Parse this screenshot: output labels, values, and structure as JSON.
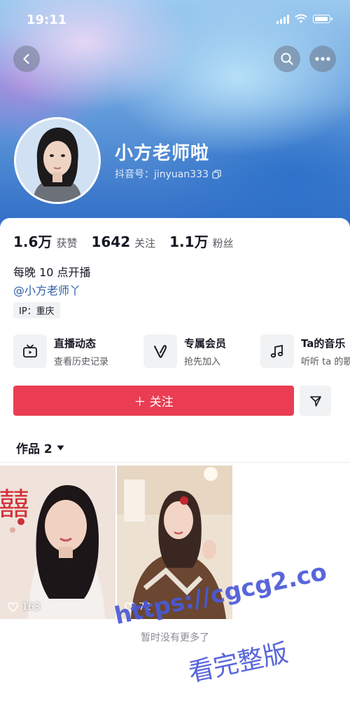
{
  "status_bar": {
    "time": "19:11"
  },
  "profile": {
    "nickname": "小方老师啦",
    "douyin_id": "抖音号：jinyuan333",
    "stats": [
      {
        "value": "1.6万",
        "label": "获赞"
      },
      {
        "value": "1642",
        "label": "关注"
      },
      {
        "value": "1.1万",
        "label": "粉丝"
      }
    ],
    "bio": "每晚 10 点开播",
    "mention": "@小方老师丫",
    "ip": "IP：重庆"
  },
  "features": [
    {
      "title": "直播动态",
      "subtitle": "查看历史记录",
      "icon": "tv-icon"
    },
    {
      "title": "专属会员",
      "subtitle": "抢先加入",
      "icon": "v-icon"
    },
    {
      "title": "Ta的音乐",
      "subtitle": "听听 ta 的歌",
      "icon": "music-note-icon"
    }
  ],
  "actions": {
    "follow_label": "＋ 关注"
  },
  "works": {
    "tab_label": "作品 2",
    "items": [
      {
        "likes": "163"
      },
      {
        "likes": "72"
      }
    ],
    "no_more_text": "暂时没有更多了"
  },
  "watermark": {
    "line1": "https://cgcg2.co",
    "line2": "看完整版"
  },
  "colors": {
    "accent": "#ea3d53",
    "mention": "#2d5fa8",
    "watermark": "#4a5ad8"
  }
}
